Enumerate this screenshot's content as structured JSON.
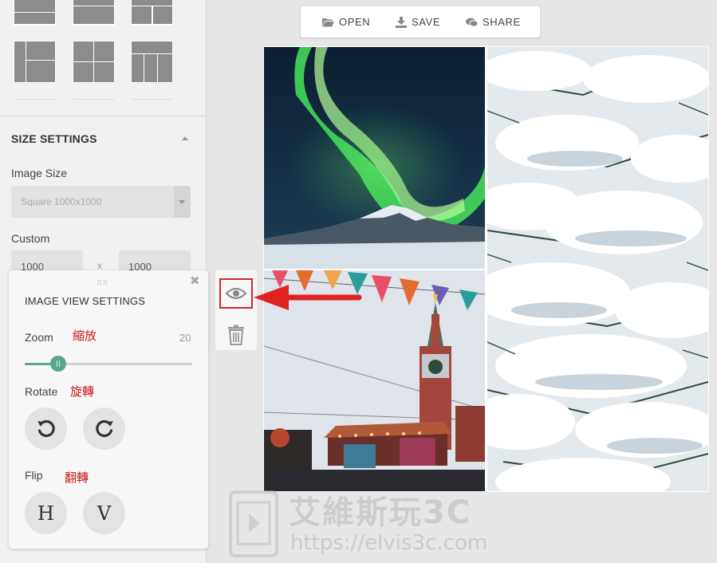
{
  "toolbar": {
    "open_label": "OPEN",
    "save_label": "SAVE",
    "share_label": "SHARE"
  },
  "sidebar": {
    "size_settings_title": "SIZE SETTINGS",
    "image_size_label": "Image Size",
    "image_size_value": "Square 1000x1000",
    "custom_label": "Custom",
    "custom_width": "1000",
    "custom_separator": "x",
    "custom_height": "1000"
  },
  "image_view": {
    "title": "IMAGE VIEW SETTINGS",
    "zoom_label": "Zoom",
    "zoom_note": "縮放",
    "zoom_value": "20",
    "zoom_fraction": 0.2,
    "rotate_label": "Rotate",
    "rotate_note": "旋轉",
    "flip_label": "Flip",
    "flip_note": "翻轉",
    "flip_h_label": "H",
    "flip_v_label": "V"
  },
  "watermark": {
    "title": "艾維斯玩3C",
    "url": "https://elvis3c.com"
  },
  "colors": {
    "accent": "#5aa88c",
    "annotation": "#cc2a2a"
  }
}
